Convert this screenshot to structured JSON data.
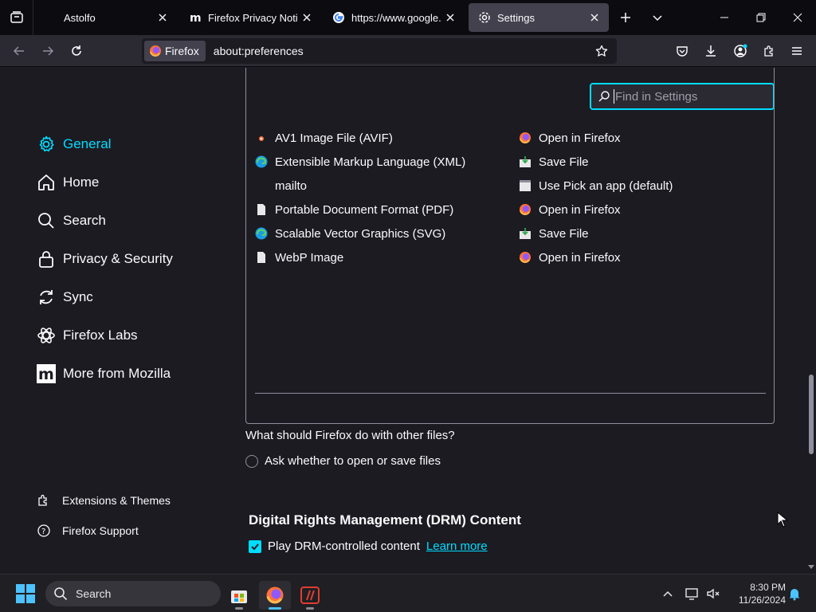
{
  "tabs": [
    {
      "label": "Astolfo",
      "favicon": "blank"
    },
    {
      "label": "Firefox Privacy Notice -",
      "favicon": "mozilla-m-icon"
    },
    {
      "label": "https://www.google.co",
      "favicon": "google-icon"
    },
    {
      "label": "Settings",
      "favicon": "gear-icon",
      "active": true
    }
  ],
  "navbar": {
    "identity_label": "Firefox",
    "url": "about:preferences"
  },
  "search": {
    "placeholder": "Find in Settings"
  },
  "sidebar": {
    "categories": [
      {
        "label": "General",
        "icon": "gear-icon",
        "selected": true
      },
      {
        "label": "Home",
        "icon": "home-icon"
      },
      {
        "label": "Search",
        "icon": "search-icon"
      },
      {
        "label": "Privacy & Security",
        "icon": "lock-icon"
      },
      {
        "label": "Sync",
        "icon": "sync-icon"
      },
      {
        "label": "Firefox Labs",
        "icon": "flask-icon"
      },
      {
        "label": "More from Mozilla",
        "icon": "mozilla-m-icon"
      }
    ],
    "footer": [
      {
        "label": "Extensions & Themes",
        "icon": "puzzle-icon"
      },
      {
        "label": "Firefox Support",
        "icon": "help-icon"
      }
    ]
  },
  "applications": [
    {
      "content_type": "AV1 Image File (AVIF)",
      "type_icon": "avif-icon",
      "action": "Open in Firefox",
      "action_icon": "firefox-icon"
    },
    {
      "content_type": "Extensible Markup Language (XML)",
      "type_icon": "edge-icon",
      "action": "Save File",
      "action_icon": "save-file-icon"
    },
    {
      "content_type": "mailto",
      "type_icon": "none",
      "action": "Use Pick an app (default)",
      "action_icon": "app-picker-icon"
    },
    {
      "content_type": "Portable Document Format (PDF)",
      "type_icon": "document-icon",
      "action": "Open in Firefox",
      "action_icon": "firefox-icon"
    },
    {
      "content_type": "Scalable Vector Graphics (SVG)",
      "type_icon": "edge-icon",
      "action": "Save File",
      "action_icon": "save-file-icon"
    },
    {
      "content_type": "WebP Image",
      "type_icon": "document-icon",
      "action": "Open in Firefox",
      "action_icon": "firefox-icon"
    }
  ],
  "other_files": {
    "question": "What should Firefox do with other files?",
    "option_label": "Ask whether to open or save files",
    "selected": false
  },
  "drm": {
    "heading": "Digital Rights Management (DRM) Content",
    "checkbox_label": "Play DRM-controlled content",
    "checked": true,
    "learn_more": "Learn more"
  },
  "taskbar": {
    "search_label": "Search",
    "time": "8:30 PM",
    "date": "11/26/2024"
  },
  "colors": {
    "accent": "#00ddff",
    "content_bg": "#1c1b22",
    "toolbar_bg": "#2b2a33",
    "tabstrip_bg": "#0c0b10"
  }
}
